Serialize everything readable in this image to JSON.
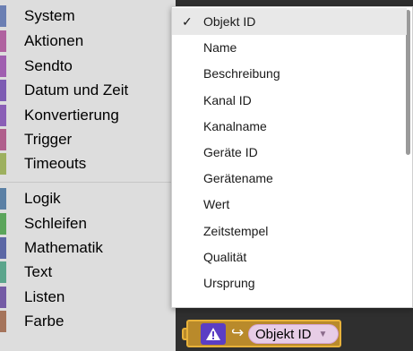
{
  "toolbox": {
    "items": [
      {
        "label": "System",
        "color": "#6b7fb3"
      },
      {
        "label": "Aktionen",
        "color": "#b062a0"
      },
      {
        "label": "Sendto",
        "color": "#a05fb0"
      },
      {
        "label": "Datum und Zeit",
        "color": "#7d5cb3"
      },
      {
        "label": "Konvertierung",
        "color": "#8a5fb6"
      },
      {
        "label": "Trigger",
        "color": "#b05f8c"
      },
      {
        "label": "Timeouts",
        "color": "#9db05f"
      },
      {
        "label": "Logik",
        "color": "#5b80a5"
      },
      {
        "label": "Schleifen",
        "color": "#5ba55b"
      },
      {
        "label": "Mathematik",
        "color": "#5b67a5"
      },
      {
        "label": "Text",
        "color": "#5ba58c"
      },
      {
        "label": "Listen",
        "color": "#745ba5"
      },
      {
        "label": "Farbe",
        "color": "#a5745b"
      }
    ]
  },
  "dropdown": {
    "check_glyph": "✓",
    "items": [
      {
        "label": "Objekt ID",
        "selected": true
      },
      {
        "label": "Name",
        "selected": false
      },
      {
        "label": "Beschreibung",
        "selected": false
      },
      {
        "label": "Kanal ID",
        "selected": false
      },
      {
        "label": "Kanalname",
        "selected": false
      },
      {
        "label": "Geräte ID",
        "selected": false
      },
      {
        "label": "Gerätename",
        "selected": false
      },
      {
        "label": "Wert",
        "selected": false
      },
      {
        "label": "Zeitstempel",
        "selected": false
      },
      {
        "label": "Qualität",
        "selected": false
      },
      {
        "label": "Ursprung",
        "selected": false
      }
    ]
  },
  "block": {
    "warning_icon": "warning-triangle-icon",
    "arrow_glyph": "↪",
    "field_value": "Objekt ID",
    "caret_glyph": "▼",
    "colors": {
      "block_fill": "#b98a2b",
      "block_border": "#e8b23a",
      "warning_fill": "#5b3ec4",
      "field_fill": "#e7cde6"
    }
  }
}
